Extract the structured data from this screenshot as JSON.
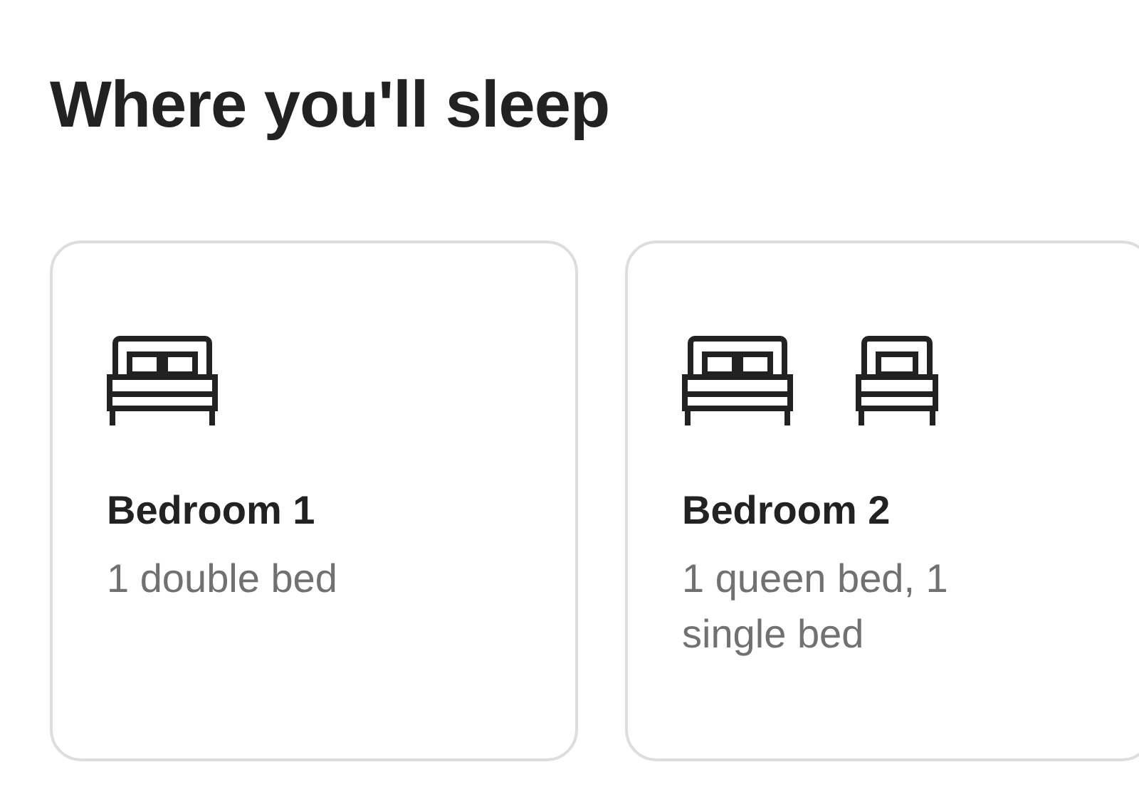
{
  "title": "Where you'll sleep",
  "rooms": [
    {
      "name": "Bedroom 1",
      "beds": [
        {
          "kind": "double"
        }
      ],
      "description": "1 double bed"
    },
    {
      "name": "Bedroom 2",
      "beds": [
        {
          "kind": "double"
        },
        {
          "kind": "single"
        }
      ],
      "description": "1 queen bed, 1 single bed"
    }
  ]
}
